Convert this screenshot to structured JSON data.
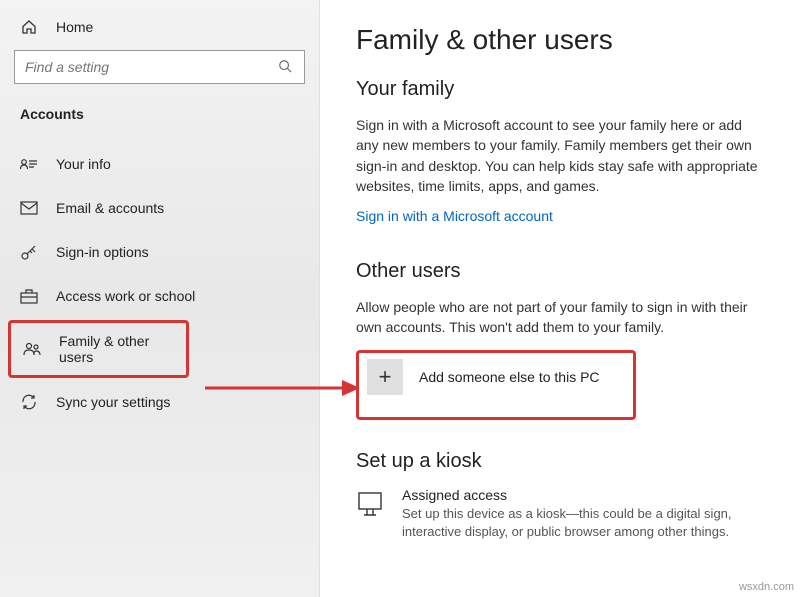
{
  "sidebar": {
    "home": "Home",
    "search_placeholder": "Find a setting",
    "section": "Accounts",
    "items": [
      {
        "label": "Your info"
      },
      {
        "label": "Email & accounts"
      },
      {
        "label": "Sign-in options"
      },
      {
        "label": "Access work or school"
      },
      {
        "label": "Family & other users"
      },
      {
        "label": "Sync your settings"
      }
    ]
  },
  "main": {
    "title": "Family & other users",
    "your_family": {
      "heading": "Your family",
      "body": "Sign in with a Microsoft account to see your family here or add any new members to your family. Family members get their own sign-in and desktop. You can help kids stay safe with appropriate websites, time limits, apps, and games.",
      "link": "Sign in with a Microsoft account"
    },
    "other_users": {
      "heading": "Other users",
      "body": "Allow people who are not part of your family to sign in with their own accounts. This won't add them to your family.",
      "add_label": "Add someone else to this PC"
    },
    "kiosk": {
      "heading": "Set up a kiosk",
      "title": "Assigned access",
      "desc": "Set up this device as a kiosk—this could be a digital sign, interactive display, or public browser among other things."
    }
  },
  "watermark": "wsxdn.com"
}
